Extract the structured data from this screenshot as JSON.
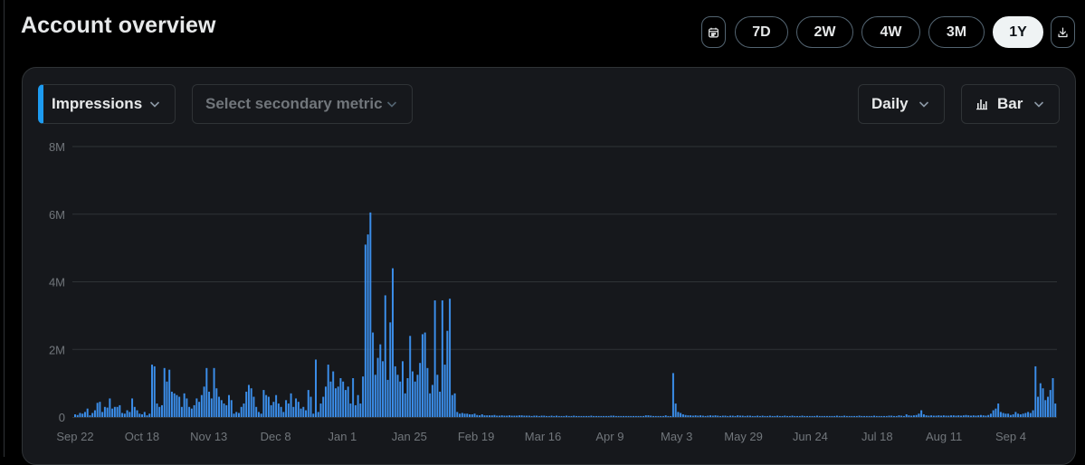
{
  "page": {
    "title": "Account overview"
  },
  "toolbar": {
    "ranges": [
      {
        "label": "7D",
        "selected": false
      },
      {
        "label": "2W",
        "selected": false
      },
      {
        "label": "4W",
        "selected": false
      },
      {
        "label": "3M",
        "selected": false
      },
      {
        "label": "1Y",
        "selected": true
      }
    ]
  },
  "controls": {
    "primary_metric": "Impressions",
    "secondary_metric_placeholder": "Select secondary metric",
    "granularity": "Daily",
    "chart_type": "Bar"
  },
  "colors": {
    "accent": "#1d9bf0",
    "bar": "#3b8eea",
    "card_bg": "#16181c",
    "grid": "#2f3336"
  },
  "chart_data": {
    "type": "bar",
    "title": "",
    "xlabel": "",
    "ylabel": "",
    "ylim": [
      0,
      8000000
    ],
    "y_ticks": [
      "0",
      "2M",
      "4M",
      "6M",
      "8M"
    ],
    "x_ticks": [
      "Sep 22",
      "Oct 18",
      "Nov 13",
      "Dec 8",
      "Jan 1",
      "Jan 25",
      "Feb 19",
      "Mar 16",
      "Apr 9",
      "May 3",
      "May 29",
      "Jun 24",
      "Jul 18",
      "Aug 11",
      "Sep 4"
    ],
    "grid": true,
    "series": [
      {
        "values": [
          0.08,
          0.06,
          0.12,
          0.1,
          0.15,
          0.25,
          0.05,
          0.12,
          0.2,
          0.42,
          0.45,
          0.15,
          0.3,
          0.28,
          0.55,
          0.25,
          0.3,
          0.3,
          0.35,
          0.12,
          0.1,
          0.2,
          0.15,
          0.55,
          0.3,
          0.2,
          0.1,
          0.08,
          0.15,
          0.05,
          0.1,
          1.55,
          1.5,
          0.4,
          0.3,
          0.35,
          1.45,
          1.05,
          1.4,
          0.75,
          0.7,
          0.65,
          0.6,
          0.3,
          0.7,
          0.55,
          0.3,
          0.25,
          0.35,
          0.55,
          0.45,
          0.65,
          0.9,
          1.45,
          0.75,
          0.55,
          1.45,
          0.85,
          0.6,
          0.5,
          0.4,
          0.35,
          0.65,
          0.5,
          0.1,
          0.15,
          0.12,
          0.3,
          0.4,
          0.75,
          0.95,
          0.85,
          0.6,
          0.3,
          0.15,
          0.1,
          0.8,
          0.65,
          0.6,
          0.35,
          0.45,
          0.65,
          0.4,
          0.3,
          0.15,
          0.5,
          0.4,
          0.7,
          0.3,
          0.55,
          0.45,
          0.25,
          0.3,
          0.2,
          0.8,
          0.6,
          0.1,
          1.7,
          0.15,
          0.4,
          0.6,
          0.9,
          1.55,
          1.05,
          1.35,
          0.85,
          0.9,
          1.15,
          1.05,
          0.8,
          0.9,
          0.4,
          1.15,
          0.35,
          0.65,
          0.4,
          1.2,
          5.1,
          5.4,
          6.05,
          2.5,
          1.25,
          1.75,
          2.15,
          1.65,
          3.6,
          1.1,
          2.8,
          4.4,
          1.5,
          1.25,
          1.05,
          1.65,
          0.7,
          1.15,
          2.4,
          1.35,
          1.05,
          1.25,
          1.6,
          2.45,
          2.5,
          1.45,
          0.7,
          0.95,
          3.45,
          1.25,
          0.75,
          3.45,
          1.55,
          2.55,
          3.5,
          0.65,
          0.7,
          0.15,
          0.1,
          0.12,
          0.1,
          0.1,
          0.08,
          0.08,
          0.1,
          0.06,
          0.05,
          0.08,
          0.05,
          0.05,
          0.05,
          0.05,
          0.06,
          0.04,
          0.04,
          0.05,
          0.04,
          0.04,
          0.05,
          0.04,
          0.04,
          0.04,
          0.05,
          0.05,
          0.04,
          0.04,
          0.04,
          0.03,
          0.04,
          0.04,
          0.03,
          0.04,
          0.04,
          0.03,
          0.03,
          0.04,
          0.03,
          0.04,
          0.03,
          0.03,
          0.03,
          0.04,
          0.03,
          0.03,
          0.04,
          0.03,
          0.03,
          0.03,
          0.03,
          0.03,
          0.03,
          0.04,
          0.03,
          0.03,
          0.03,
          0.03,
          0.03,
          0.03,
          0.03,
          0.04,
          0.04,
          0.03,
          0.03,
          0.03,
          0.03,
          0.03,
          0.03,
          0.03,
          0.03,
          0.03,
          0.03,
          0.03,
          0.03,
          0.05,
          0.05,
          0.04,
          0.03,
          0.03,
          0.03,
          0.03,
          0.03,
          0.05,
          0.03,
          0.03,
          1.3,
          0.4,
          0.15,
          0.12,
          0.08,
          0.06,
          0.05,
          0.05,
          0.04,
          0.05,
          0.04,
          0.05,
          0.04,
          0.03,
          0.04,
          0.05,
          0.04,
          0.05,
          0.04,
          0.03,
          0.04,
          0.04,
          0.03,
          0.04,
          0.04,
          0.03,
          0.05,
          0.04,
          0.04,
          0.03,
          0.04,
          0.04,
          0.03,
          0.03,
          0.04,
          0.03,
          0.04,
          0.03,
          0.03,
          0.04,
          0.03,
          0.03,
          0.04,
          0.03,
          0.03,
          0.04,
          0.03,
          0.03,
          0.04,
          0.03,
          0.03,
          0.03,
          0.04,
          0.03,
          0.03,
          0.03,
          0.03,
          0.03,
          0.04,
          0.03,
          0.03,
          0.03,
          0.03,
          0.03,
          0.03,
          0.03,
          0.04,
          0.03,
          0.03,
          0.04,
          0.03,
          0.03,
          0.03,
          0.03,
          0.03,
          0.04,
          0.03,
          0.03,
          0.03,
          0.03,
          0.03,
          0.04,
          0.03,
          0.03,
          0.03,
          0.03,
          0.03,
          0.04,
          0.04,
          0.03,
          0.03,
          0.05,
          0.04,
          0.03,
          0.08,
          0.05,
          0.04,
          0.05,
          0.06,
          0.1,
          0.2,
          0.08,
          0.05,
          0.04,
          0.05,
          0.04,
          0.04,
          0.05,
          0.04,
          0.05,
          0.04,
          0.04,
          0.05,
          0.05,
          0.04,
          0.05,
          0.04,
          0.05,
          0.06,
          0.05,
          0.04,
          0.05,
          0.04,
          0.05,
          0.06,
          0.05,
          0.04,
          0.06,
          0.1,
          0.2,
          0.25,
          0.4,
          0.15,
          0.12,
          0.1,
          0.1,
          0.06,
          0.08,
          0.15,
          0.1,
          0.08,
          0.1,
          0.12,
          0.15,
          0.12,
          0.2,
          1.5,
          0.6,
          1.0,
          0.85,
          0.5,
          0.6,
          0.8,
          1.15,
          0.4
        ]
      }
    ],
    "value_unit": "M"
  }
}
